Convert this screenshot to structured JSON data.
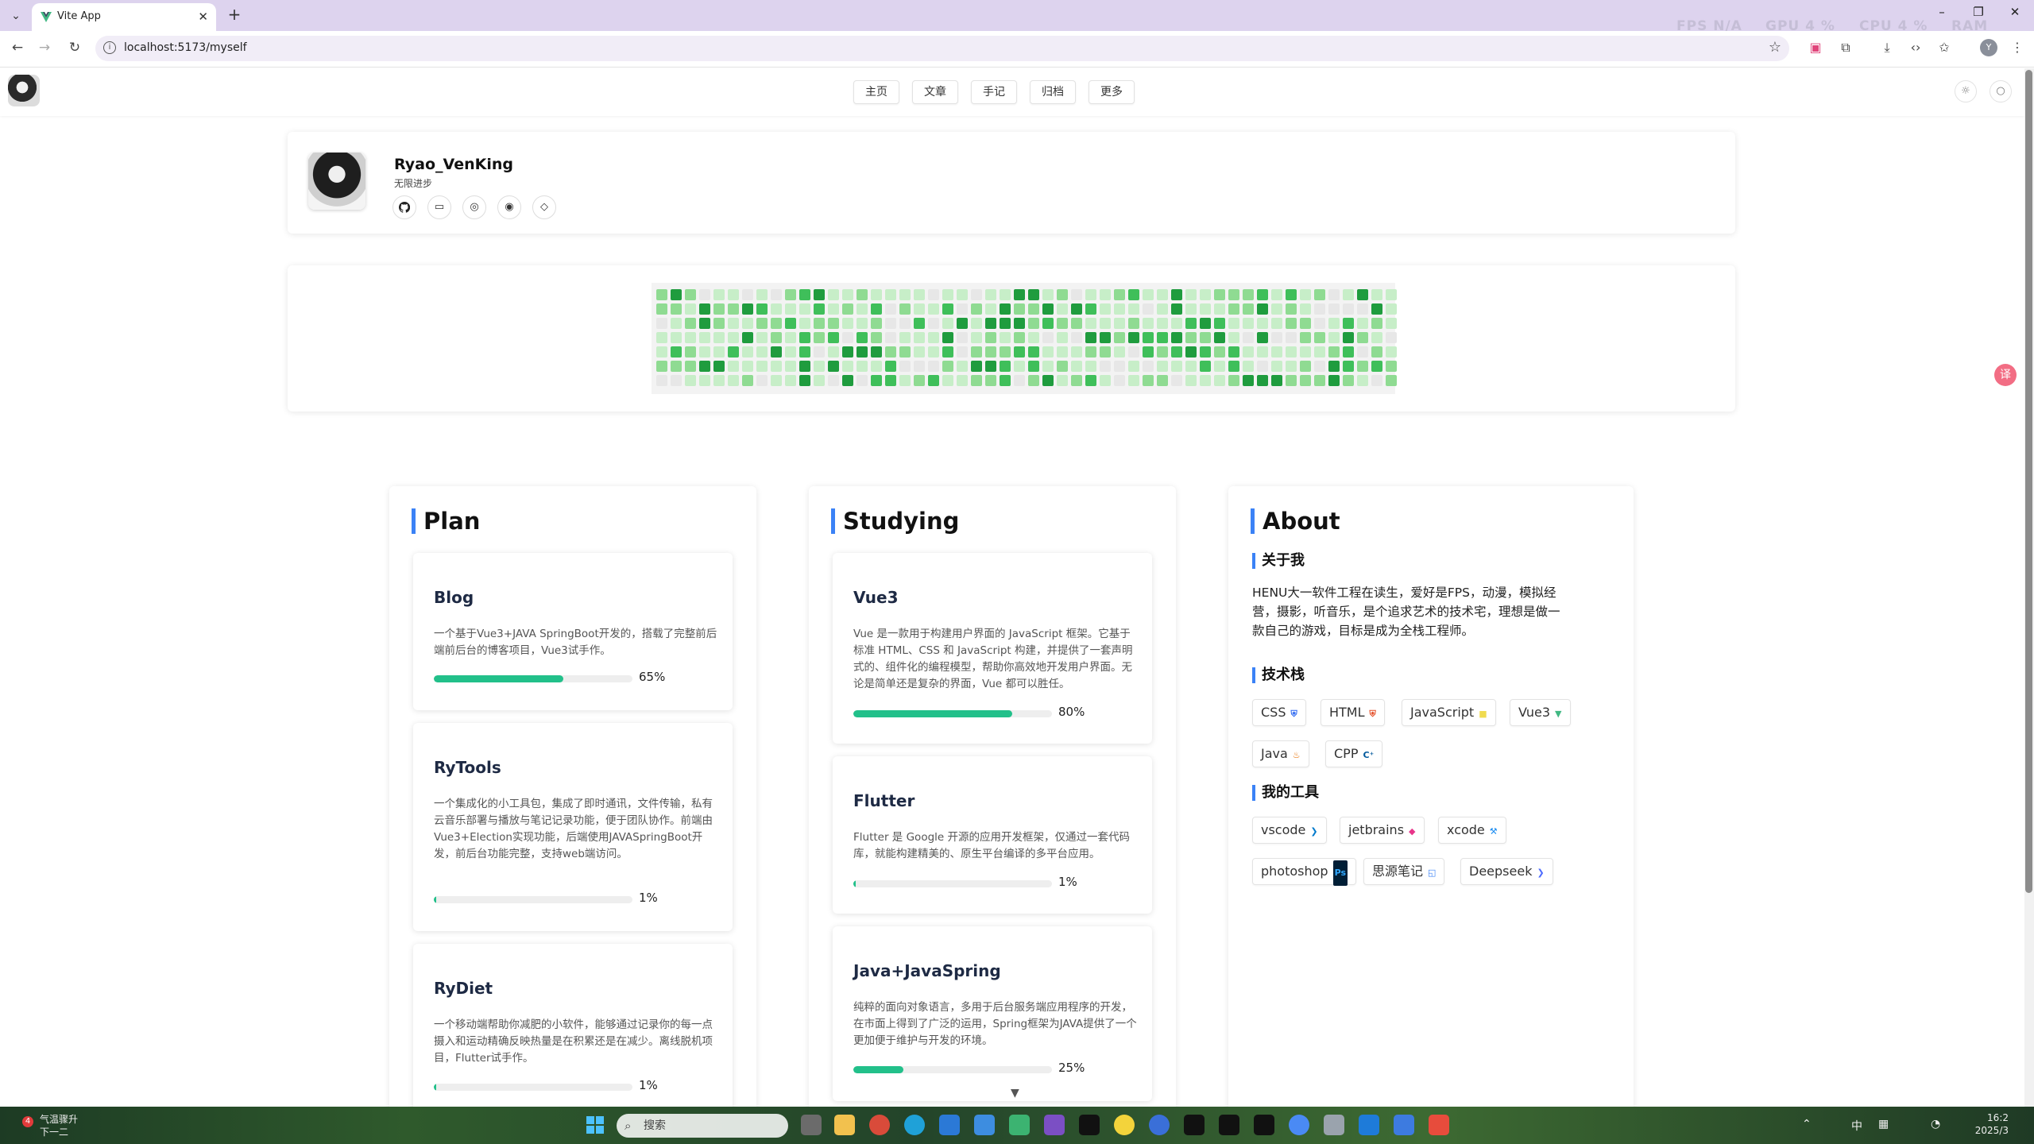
{
  "browser": {
    "tab_title": "Vite App",
    "url": "localhost:5173/myself",
    "perf_overlay": [
      "FPS  N/A",
      "GPU  4 %",
      "CPU  4 %",
      "RAM"
    ],
    "profile_initial": "Y"
  },
  "header": {
    "nav": [
      "主页",
      "文章",
      "手记",
      "归档",
      "更多"
    ],
    "theme_icon": "☼",
    "search_icon": "○"
  },
  "profile": {
    "name": "Ryao_VenKing",
    "motto": "无限进步",
    "social_icons": [
      "github-icon",
      "bilibili-icon",
      "csdn-icon",
      "weibo-icon",
      "juejin-icon"
    ]
  },
  "heatmap": {
    "levels_hex": [
      "#e7e7e7",
      "#c7eec8",
      "#8fdb92",
      "#3fbf5a",
      "#1f9c3e"
    ],
    "columns": 52
  },
  "plan": {
    "title": "Plan",
    "items": [
      {
        "title": "Blog",
        "desc": "一个基于Vue3+JAVA SpringBoot开发的，搭载了完整前后端前后台的博客项目，Vue3试手作。",
        "progress": 65,
        "progress_label": "65%"
      },
      {
        "title": "RyTools",
        "desc": "一个集成化的小工具包，集成了即时通讯，文件传输，私有云音乐部署与播放与笔记记录功能，便于团队协作。前端由Vue3+Election实现功能，后端使用JAVASpringBoot开发，前后台功能完整，支持web端访问。",
        "progress": 1,
        "progress_label": "1%"
      },
      {
        "title": "RyDiet",
        "desc": "一个移动端帮助你减肥的小软件，能够通过记录你的每一点摄入和运动精确反映热量是在积累还是在减少。离线脱机项目，Flutter试手作。",
        "progress": 1,
        "progress_label": "1%"
      }
    ]
  },
  "studying": {
    "title": "Studying",
    "items": [
      {
        "title": "Vue3",
        "desc": "Vue 是一款用于构建用户界面的 JavaScript 框架。它基于标准 HTML、CSS 和 JavaScript 构建，并提供了一套声明式的、组件化的编程模型，帮助你高效地开发用户界面。无论是简单还是复杂的界面，Vue 都可以胜任。",
        "progress": 80,
        "progress_label": "80%"
      },
      {
        "title": "Flutter",
        "desc": "Flutter 是 Google 开源的应用开发框架，仅通过一套代码库，就能构建精美的、原生平台编译的多平台应用。",
        "progress": 1,
        "progress_label": "1%"
      },
      {
        "title": "Java+JavaSpring",
        "desc": "纯粹的面向对象语言，多用于后台服务端应用程序的开发，在市面上得到了广泛的运用，Spring框架为JAVA提供了一个更加便于维护与开发的环境。",
        "progress": 25,
        "progress_label": "25%"
      }
    ]
  },
  "about": {
    "title": "About",
    "me_title": "关于我",
    "me_text": "HENU大一软件工程在读生，爱好是FPS，动漫，模拟经营，摄影，听音乐，是个追求艺术的技术宅，理想是做一款自己的游戏，目标是成为全栈工程师。",
    "stack_title": "技术栈",
    "stack": [
      {
        "name": "CSS",
        "icon": "css-icon",
        "color": "#2965f1"
      },
      {
        "name": "HTML",
        "icon": "html-icon",
        "color": "#e44d26"
      },
      {
        "name": "JavaScript",
        "icon": "js-icon",
        "color": "#f0db4f"
      },
      {
        "name": "Vue3",
        "icon": "vue-icon",
        "color": "#41b883"
      },
      {
        "name": "Java",
        "icon": "java-icon",
        "color": "#e76f00"
      },
      {
        "name": "CPP",
        "icon": "cpp-icon",
        "color": "#00599c"
      }
    ],
    "tools_title": "我的工具",
    "tools": [
      {
        "name": "vscode",
        "icon": "vscode-icon",
        "color": "#007acc"
      },
      {
        "name": "jetbrains",
        "icon": "jetbrains-icon",
        "color": "#e8358a"
      },
      {
        "name": "xcode",
        "icon": "xcode-icon",
        "color": "#1c8cf0"
      },
      {
        "name": "photoshop",
        "icon": "photoshop-icon",
        "color": "#001e36"
      },
      {
        "name": "思源笔记",
        "icon": "siyuan-icon",
        "color": "#3b82f6"
      },
      {
        "name": "Deepseek",
        "icon": "deepseek-icon",
        "color": "#4d6bfe"
      }
    ]
  },
  "taskbar": {
    "weather_line1": "气温骤升",
    "weather_line2": "下一二",
    "weather_badge": "4",
    "search_placeholder": "搜索",
    "tray_ime": "中",
    "clock_time": "16:2",
    "clock_date": "2025/3"
  }
}
